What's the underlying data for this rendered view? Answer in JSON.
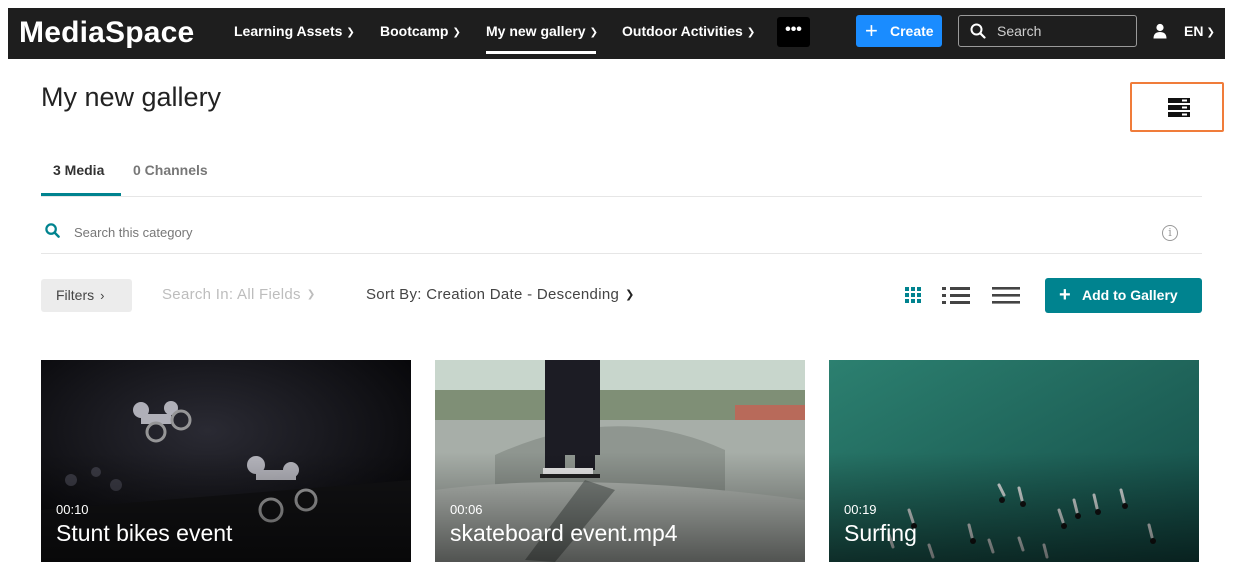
{
  "app": {
    "logo": "MediaSpace"
  },
  "nav": {
    "items": [
      {
        "label": "Learning Assets"
      },
      {
        "label": "Bootcamp"
      },
      {
        "label": "My new gallery"
      },
      {
        "label": "Outdoor Activities"
      }
    ],
    "more_label": "•••",
    "create_label": "Create",
    "search_placeholder": "Search",
    "language": "EN"
  },
  "page": {
    "title": "My new gallery"
  },
  "tabs": [
    {
      "label": "3 Media",
      "active": true
    },
    {
      "label": "0 Channels",
      "active": false
    }
  ],
  "category_search": {
    "placeholder": "Search this category",
    "info_icon": "i"
  },
  "toolbar": {
    "filters_label": "Filters",
    "search_in_label": "Search In: All Fields",
    "sort_by_label": "Sort By: Creation Date - Descending",
    "add_label": "Add to Gallery"
  },
  "colors": {
    "topbar": "#1e1e1e",
    "create_button": "#1a8cff",
    "accent": "#00838f",
    "highlight_border": "#f07c3a"
  },
  "media": [
    {
      "duration": "00:10",
      "title": "Stunt bikes event"
    },
    {
      "duration": "00:06",
      "title": "skateboard event.mp4"
    },
    {
      "duration": "00:19",
      "title": "Surfing"
    }
  ]
}
